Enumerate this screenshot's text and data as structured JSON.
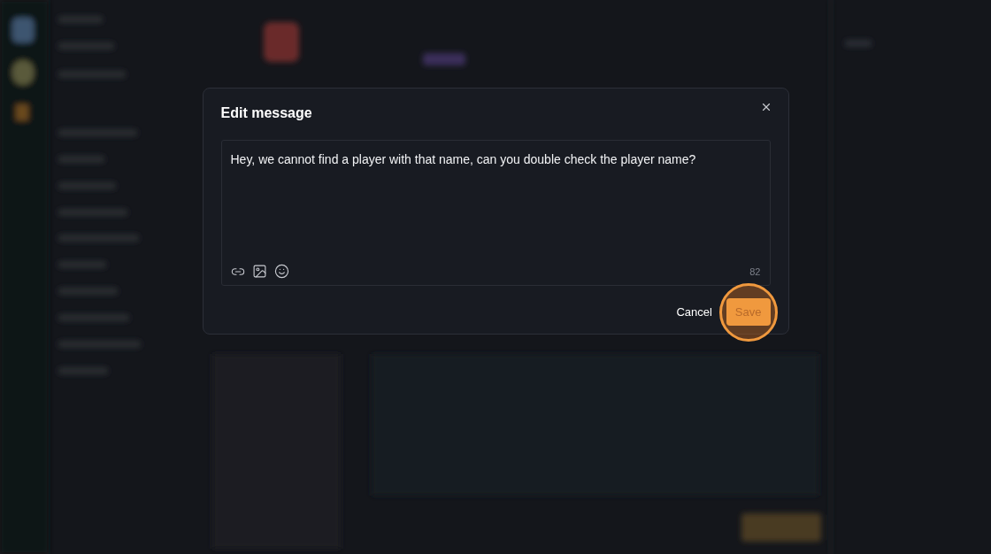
{
  "dialog": {
    "title": "Edit message",
    "message": {
      "value": "Hey, we cannot find a player with that name, can you double check the player name?",
      "char_count": "82"
    },
    "toolbar": [
      {
        "kind": "link"
      },
      {
        "kind": "image"
      },
      {
        "kind": "emoji"
      }
    ],
    "buttons": [
      {
        "label": "Cancel",
        "kind": "secondary",
        "disabled": false,
        "highlighted": false
      },
      {
        "label": "Save",
        "kind": "primary",
        "disabled": true,
        "highlighted": true
      }
    ]
  }
}
